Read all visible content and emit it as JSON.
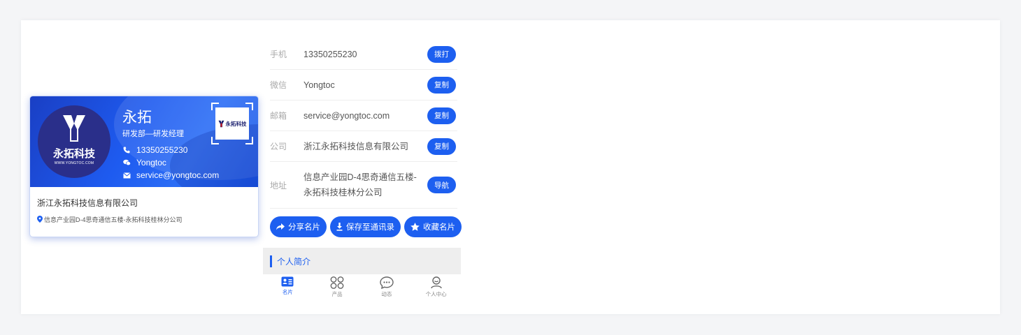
{
  "card": {
    "name": "永拓",
    "title": "研发部—研发经理",
    "phone": "13350255230",
    "wechat": "Yongtoc",
    "email": "service@yongtoc.com",
    "company": "浙江永拓科技信息有限公司",
    "address": "信息产业园D-4思奇通信五楼-永拓科技桂林分公司",
    "logo_cn": "永拓科技",
    "logo_en": "WWW.YONGTOC.COM",
    "qr_text": "永拓科技"
  },
  "info": {
    "rows": [
      {
        "label": "手机",
        "value": "13350255230",
        "button": "拨打"
      },
      {
        "label": "微信",
        "value": "Yongtoc",
        "button": "复制"
      },
      {
        "label": "邮箱",
        "value": "service@yongtoc.com",
        "button": "复制"
      },
      {
        "label": "公司",
        "value": "浙江永拓科技信息有限公司",
        "button": "复制"
      },
      {
        "label": "地址",
        "value": "信息产业园D-4思奇通信五楼-永拓科技桂林分公司",
        "button": "导航"
      }
    ]
  },
  "actions": {
    "share": "分享名片",
    "save": "保存至通讯录",
    "favorite": "收藏名片"
  },
  "section": {
    "intro": "个人简介"
  },
  "tabs": [
    {
      "label": "名片",
      "icon": "card-icon"
    },
    {
      "label": "产品",
      "icon": "grid-icon"
    },
    {
      "label": "动态",
      "icon": "chat-icon"
    },
    {
      "label": "个人中心",
      "icon": "user-icon"
    }
  ],
  "colors": {
    "accent": "#1d5ff0",
    "logo_bg": "#2a2f8a"
  }
}
